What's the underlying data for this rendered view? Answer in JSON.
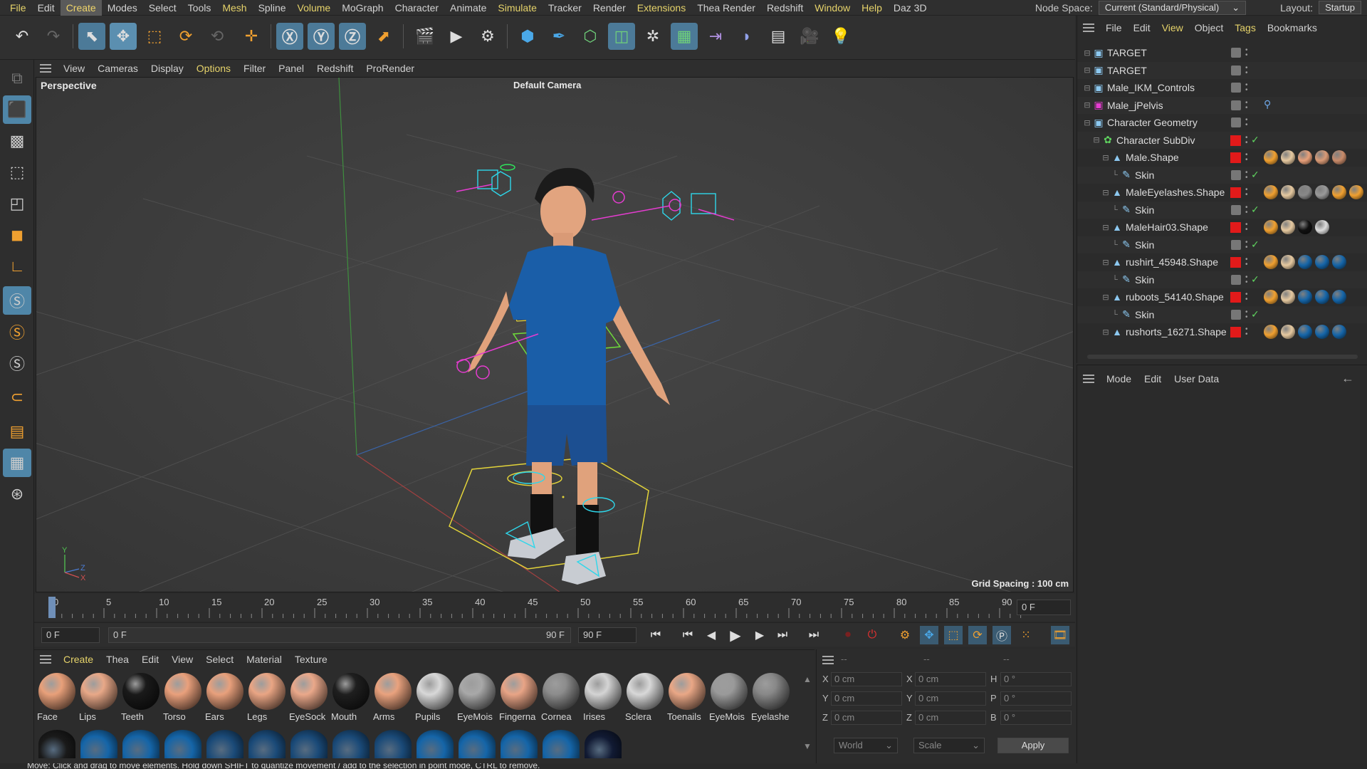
{
  "menubar": {
    "items": [
      "File",
      "Edit",
      "Create",
      "Modes",
      "Select",
      "Tools",
      "Mesh",
      "Spline",
      "Volume",
      "MoGraph",
      "Character",
      "Animate",
      "Simulate",
      "Tracker",
      "Render",
      "Extensions",
      "Thea Render",
      "Redshift",
      "Window",
      "Help",
      "Daz 3D"
    ],
    "highlighted": [
      "File",
      "Mesh",
      "Volume",
      "Simulate",
      "Extensions",
      "Window",
      "Help"
    ],
    "current": "Create",
    "node_space_label": "Node Space:",
    "node_space_value": "Current (Standard/Physical)",
    "layout_label": "Layout:",
    "layout_value": "Startup"
  },
  "viewport": {
    "menu": [
      "View",
      "Cameras",
      "Display",
      "Options",
      "Filter",
      "Panel",
      "Redshift",
      "ProRender"
    ],
    "menu_highlighted": "Options",
    "label": "Perspective",
    "camera": "Default Camera",
    "grid_spacing": "Grid Spacing : 100 cm",
    "axis_y": "Y",
    "axis_z": "Z",
    "axis_x": "X"
  },
  "timeline": {
    "ticks": [
      "0",
      "5",
      "10",
      "15",
      "20",
      "25",
      "30",
      "35",
      "40",
      "45",
      "50",
      "55",
      "60",
      "65",
      "70",
      "75",
      "80",
      "85",
      "90"
    ],
    "current_frame": "0 F",
    "start_field": "0 F",
    "range_start": "0 F",
    "range_end": "90 F",
    "end_field": "90 F"
  },
  "materials": {
    "menu": [
      "Create",
      "Thea",
      "Edit",
      "View",
      "Select",
      "Material",
      "Texture"
    ],
    "menu_highlighted": "Create",
    "items": [
      {
        "label": "Face",
        "color": "#e8a07a"
      },
      {
        "label": "Lips",
        "color": "#e8a888"
      },
      {
        "label": "Teeth",
        "color": "#1a1a1a"
      },
      {
        "label": "Torso",
        "color": "#e9a07c"
      },
      {
        "label": "Ears",
        "color": "#e8a07c"
      },
      {
        "label": "Legs",
        "color": "#e9a584"
      },
      {
        "label": "EyeSock",
        "color": "#eaa88a"
      },
      {
        "label": "Mouth",
        "color": "#1f1f1f"
      },
      {
        "label": "Arms",
        "color": "#e9a27e"
      },
      {
        "label": "Pupils",
        "color": "#d8d8d8"
      },
      {
        "label": "EyeMois",
        "color": "#a8a8a8"
      },
      {
        "label": "Fingerna",
        "color": "#e8a486"
      },
      {
        "label": "Cornea",
        "color": "#8c8c8c"
      },
      {
        "label": "Irises",
        "color": "#d4d4d4"
      },
      {
        "label": "Sclera",
        "color": "#d8d8d8"
      },
      {
        "label": "Toenails",
        "color": "#e9a786"
      },
      {
        "label": "EyeMois",
        "color": "#9a9a9a"
      },
      {
        "label": "Eyelashe",
        "color": "#888888"
      }
    ],
    "row2_colors": [
      "#1a1a1a",
      "#1565a8",
      "#1565a8",
      "#1565a8",
      "#1a4a78",
      "#1a4a78",
      "#1a4a78",
      "#1a4a78",
      "#1a4a78",
      "#1565a8",
      "#1565a8",
      "#1565a8",
      "#1565a8",
      "#111a33"
    ]
  },
  "coords": {
    "header_a": "--",
    "header_b": "--",
    "header_c": "--",
    "rows": [
      {
        "l1": "X",
        "v1": "0 cm",
        "l2": "X",
        "v2": "0 cm",
        "l3": "H",
        "v3": "0 °"
      },
      {
        "l1": "Y",
        "v1": "0 cm",
        "l2": "Y",
        "v2": "0 cm",
        "l3": "P",
        "v3": "0 °"
      },
      {
        "l1": "Z",
        "v1": "0 cm",
        "l2": "Z",
        "v2": "0 cm",
        "l3": "B",
        "v3": "0 °"
      }
    ],
    "mode_select": "World",
    "scale_select": "Scale",
    "apply": "Apply"
  },
  "status": "Move: Click and drag to move elements. Hold down SHIFT to quantize movement / add to the selection in point mode, CTRL to remove.",
  "object_manager": {
    "menu": [
      "File",
      "Edit",
      "View",
      "Object",
      "Tags",
      "Bookmarks"
    ],
    "menu_highlighted": [
      "View",
      "Tags"
    ],
    "rows": [
      {
        "name": "TARGET",
        "indent": 0,
        "red": false,
        "check": false
      },
      {
        "name": "TARGET",
        "indent": 0,
        "red": false,
        "check": false
      },
      {
        "name": "Male_IKM_Controls",
        "indent": 0,
        "red": false,
        "check": false
      },
      {
        "name": "Male_jPelvis",
        "indent": 0,
        "red": false,
        "check": false
      },
      {
        "name": "Character Geometry",
        "indent": 0,
        "red": false,
        "check": false
      },
      {
        "name": "Character SubDiv",
        "indent": 1,
        "red": true,
        "check": true
      },
      {
        "name": "Male.Shape",
        "indent": 2,
        "red": true,
        "check": false
      },
      {
        "name": "Skin",
        "indent": 3,
        "red": false,
        "check": true
      },
      {
        "name": "MaleEyelashes.Shape",
        "indent": 2,
        "red": true,
        "check": false
      },
      {
        "name": "Skin",
        "indent": 3,
        "red": false,
        "check": true
      },
      {
        "name": "MaleHair03.Shape",
        "indent": 2,
        "red": true,
        "check": false
      },
      {
        "name": "Skin",
        "indent": 3,
        "red": false,
        "check": true
      },
      {
        "name": "rushirt_45948.Shape",
        "indent": 2,
        "red": true,
        "check": false
      },
      {
        "name": "Skin",
        "indent": 3,
        "red": false,
        "check": true
      },
      {
        "name": "ruboots_54140.Shape",
        "indent": 2,
        "red": true,
        "check": false
      },
      {
        "name": "Skin",
        "indent": 3,
        "red": false,
        "check": true
      },
      {
        "name": "rushorts_16271.Shape",
        "indent": 2,
        "red": true,
        "check": false
      }
    ]
  },
  "attribute_manager": {
    "menu": [
      "Mode",
      "Edit",
      "User Data"
    ]
  }
}
